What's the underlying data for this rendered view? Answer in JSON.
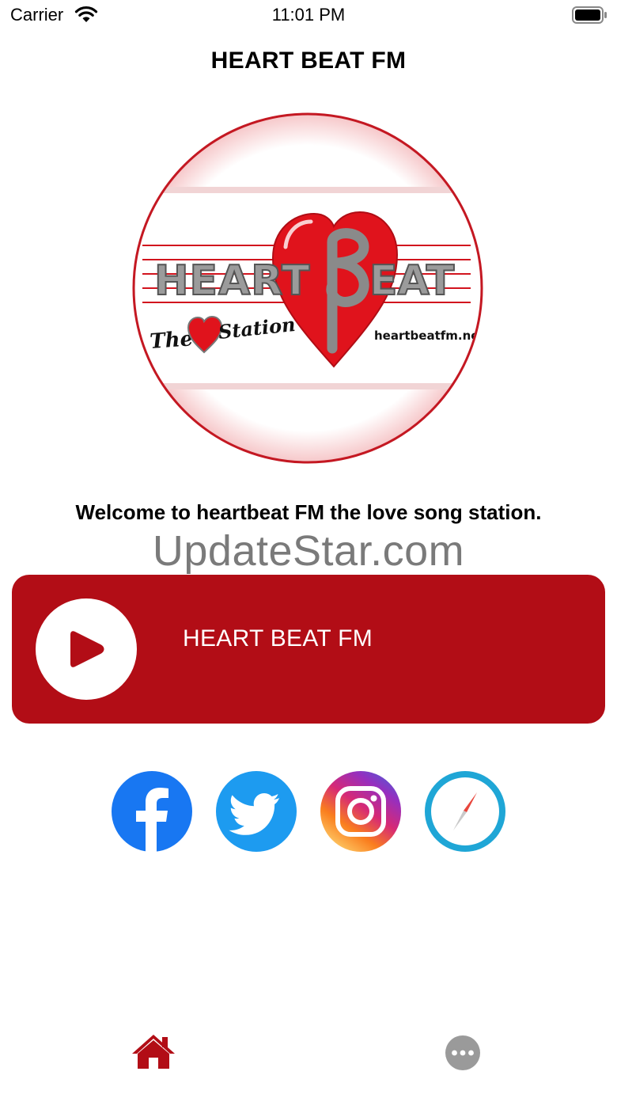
{
  "status_bar": {
    "carrier": "Carrier",
    "time": "11:01 PM"
  },
  "nav": {
    "title": "HEART BEAT FM"
  },
  "logo": {
    "brand_text": "HEARTBEAT",
    "tagline": "The Station",
    "website": "heartbeatfm.net"
  },
  "welcome_text": "Welcome to heartbeat FM the love song station.",
  "watermark": "UpdateStar.com",
  "player": {
    "station_name": "HEART BEAT FM",
    "state": "paused",
    "play_icon": "play-icon"
  },
  "social": [
    {
      "name": "Facebook",
      "icon": "facebook-icon",
      "color": "#1877f2"
    },
    {
      "name": "Twitter",
      "icon": "twitter-icon",
      "color": "#1d9bf0"
    },
    {
      "name": "Instagram",
      "icon": "instagram-icon",
      "color": "#c13584"
    },
    {
      "name": "Website",
      "icon": "compass-icon",
      "color": "#1fa6d6"
    }
  ],
  "tabs": [
    {
      "name": "Home",
      "icon": "home-icon",
      "selected": true
    },
    {
      "name": "More",
      "icon": "more-icon",
      "selected": false
    }
  ],
  "colors": {
    "accent": "#b20d16",
    "tab_inactive": "#9a9a9a"
  }
}
